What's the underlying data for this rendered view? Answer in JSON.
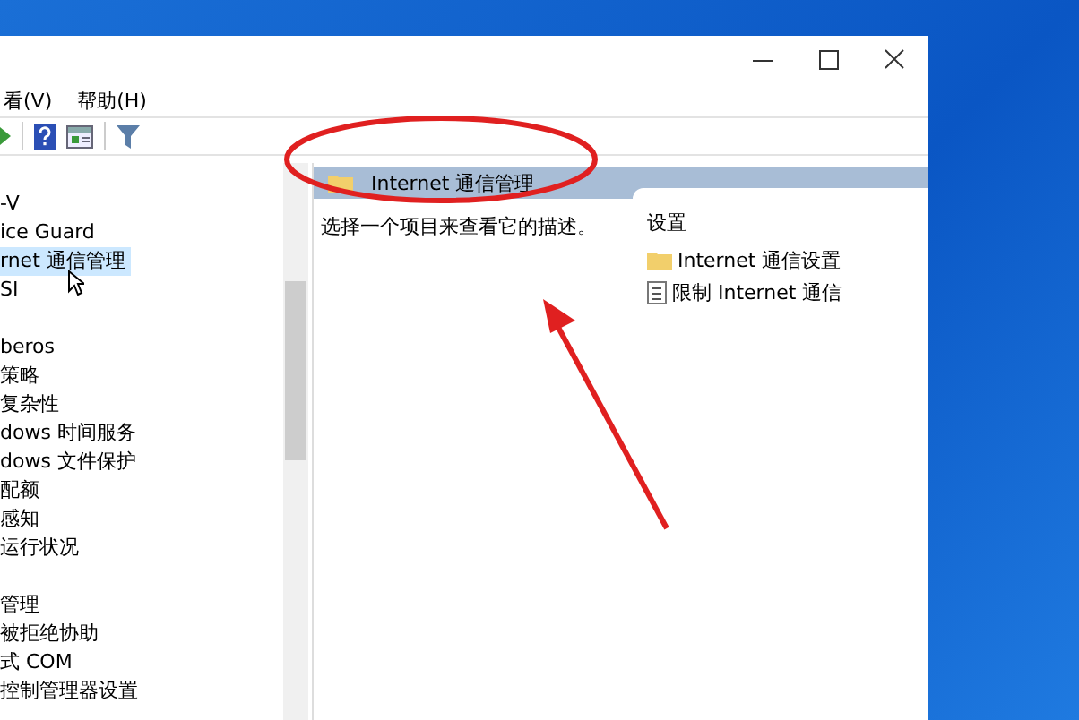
{
  "menu": [
    "看(V)",
    "帮助(H)"
  ],
  "tree": [
    {
      "label": "-V",
      "selected": false
    },
    {
      "label": "ice Guard",
      "selected": false
    },
    {
      "label": "rnet 通信管理",
      "selected": true
    },
    {
      "label": "SI",
      "selected": false
    },
    {
      "kind": "blank"
    },
    {
      "label": "beros",
      "selected": false
    },
    {
      "label": "策略",
      "selected": false
    },
    {
      "label": "复杂性",
      "selected": false
    },
    {
      "label": "dows 时间服务",
      "selected": false
    },
    {
      "label": "dows 文件保护",
      "selected": false
    },
    {
      "label": "配额",
      "selected": false
    },
    {
      "label": "感知",
      "selected": false
    },
    {
      "label": "运行状况",
      "selected": false
    },
    {
      "kind": "blank"
    },
    {
      "label": "管理",
      "selected": false
    },
    {
      "label": "被拒绝协助",
      "selected": false
    },
    {
      "label": "式 COM",
      "selected": false
    },
    {
      "label": "控制管理器设置",
      "selected": false
    }
  ],
  "detail": {
    "title": "Internet 通信管理",
    "description": "选择一个项目来查看它的描述。",
    "column_heading": "设置",
    "items": [
      {
        "kind": "folder",
        "label": "Internet 通信设置"
      },
      {
        "kind": "policy",
        "label": "限制 Internet 通信"
      }
    ]
  }
}
